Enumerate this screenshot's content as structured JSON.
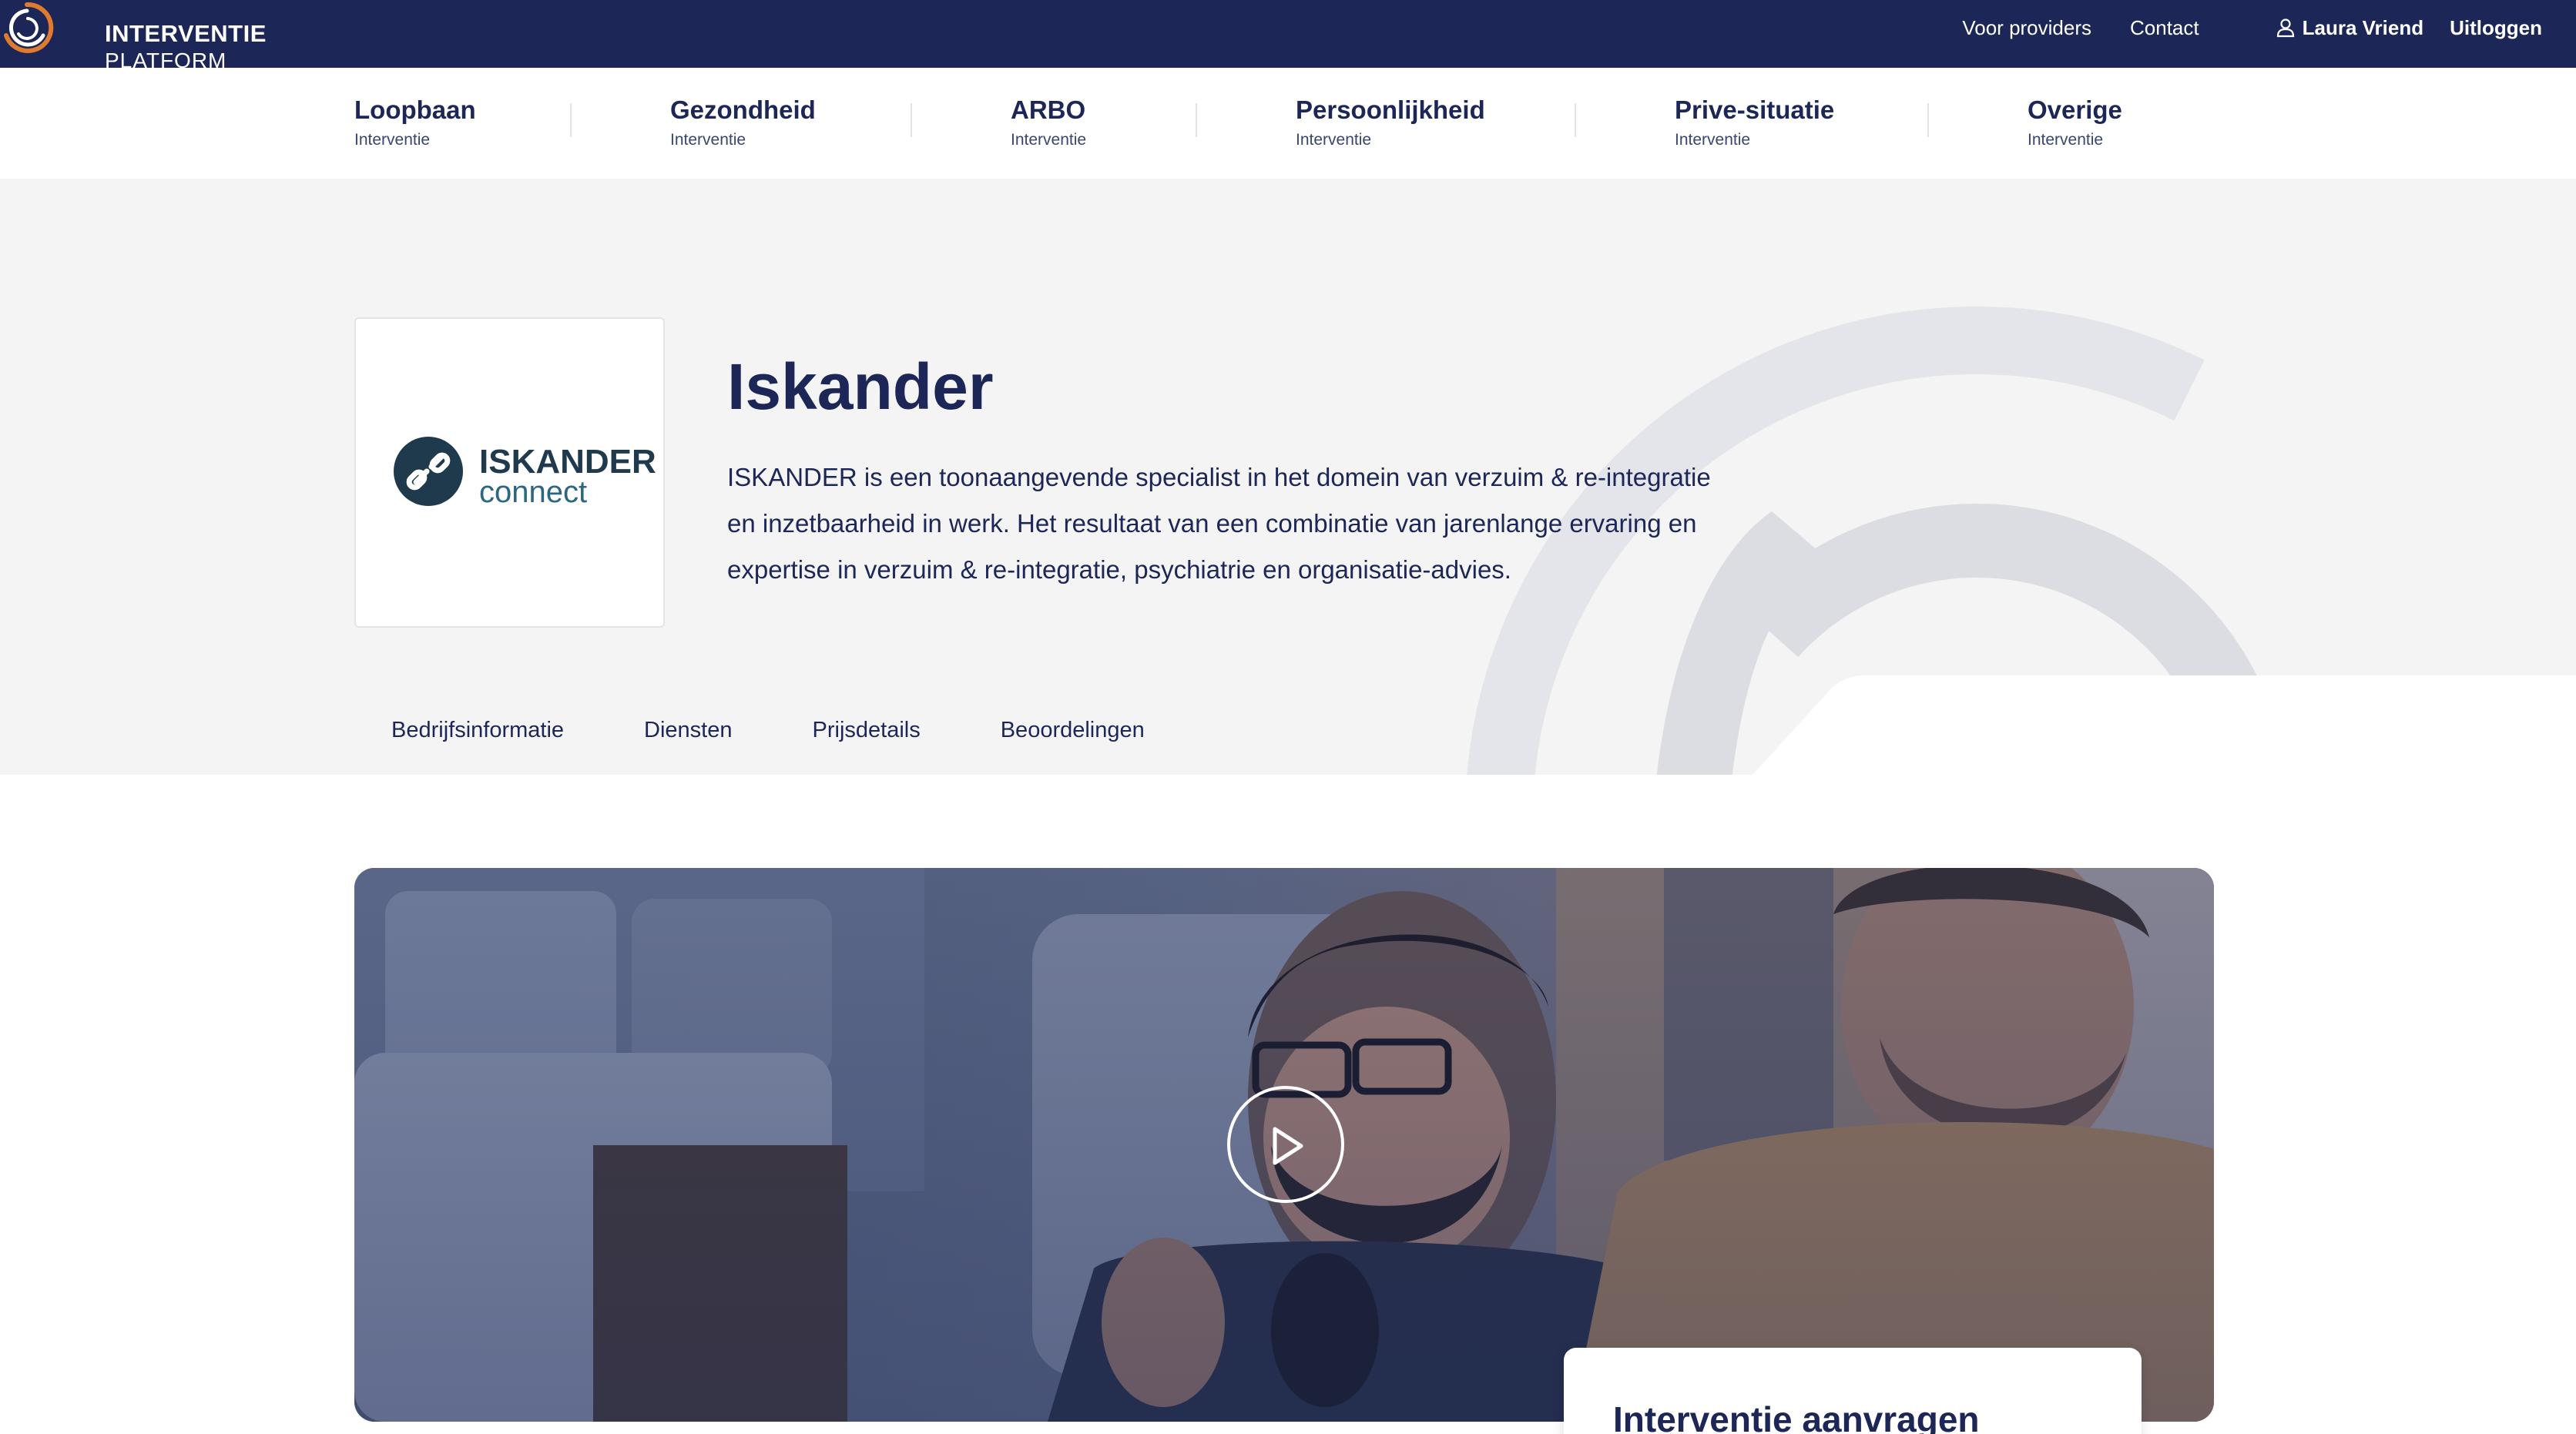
{
  "brand": {
    "line1": "INTERVENTIE",
    "line2": "PLATFORM",
    "navy": "#1c2757",
    "accent": "#e07a2f"
  },
  "utility_nav": {
    "providers": "Voor providers",
    "contact": "Contact",
    "user_icon": "user-icon",
    "user_name": "Laura Vriend",
    "logout": "Uitloggen"
  },
  "main_nav": [
    {
      "title": "Loopbaan",
      "subtitle": "Interventie"
    },
    {
      "title": "Gezondheid",
      "subtitle": "Interventie"
    },
    {
      "title": "ARBO",
      "subtitle": "Interventie"
    },
    {
      "title": "Persoonlijkheid",
      "subtitle": "Interventie"
    },
    {
      "title": "Prive-situatie",
      "subtitle": "Interventie"
    },
    {
      "title": "Overige",
      "subtitle": "Interventie"
    }
  ],
  "company": {
    "name": "Iskander",
    "logo_text_1": "ISKANDER",
    "logo_text_2": "connect",
    "description": "ISKANDER is een toonaangevende specialist in het domein van verzuim & re-integratie en inzetbaarheid in werk. Het resultaat van een combinatie van jarenlange ervaring en expertise in verzuim & re-integratie, psychiatrie en organisatie-advies."
  },
  "tabs": [
    "Bedrijfsinformatie",
    "Diensten",
    "Prijsdetails",
    "Beoordelingen"
  ],
  "media": {
    "play_icon": "play-icon"
  },
  "request_card": {
    "title": "Interventie aanvragen"
  }
}
